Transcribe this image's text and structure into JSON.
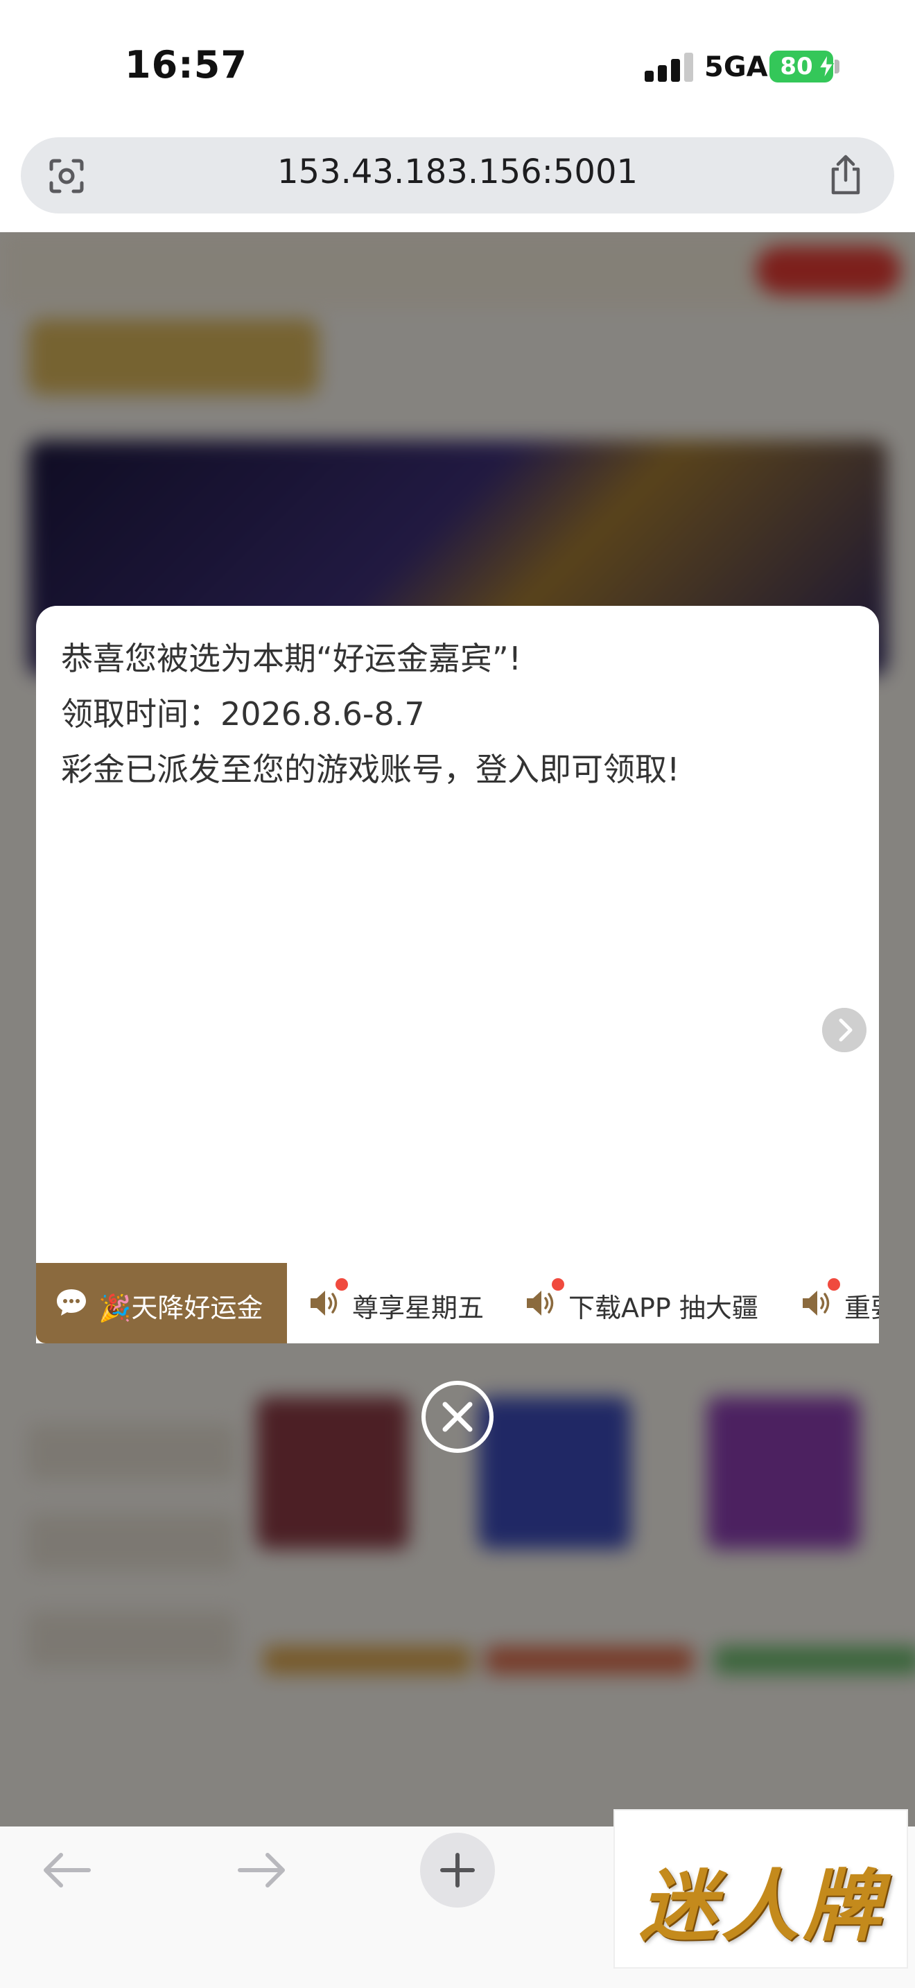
{
  "status_bar": {
    "time": "16:57",
    "network": "5GA",
    "battery": "80",
    "battery_color": "#34c759"
  },
  "browser": {
    "url": "153.43.183.156:5001",
    "left_icon": "scan-icon",
    "right_icon": "share-icon"
  },
  "modal": {
    "lines": [
      "恭喜您被选为本期“好运金嘉宾”!",
      "领取时间：2026.8.6-8.7",
      "彩金已派发至您的游戏账号，登入即可领取!"
    ],
    "tabs": [
      {
        "label": "🎉天降好运金",
        "icon": "chat-bubble-icon",
        "active": true
      },
      {
        "label": "尊享星期五",
        "icon": "speaker-icon",
        "active": false
      },
      {
        "label": "下载APP 抽大疆",
        "icon": "speaker-icon",
        "active": false
      },
      {
        "label": "重要",
        "icon": "speaker-icon",
        "active": false
      }
    ],
    "active_tab_color": "#8b6a3e",
    "notification_dot_color": "#f04a3e"
  },
  "overlay_logo": {
    "text": "迷人牌"
  }
}
